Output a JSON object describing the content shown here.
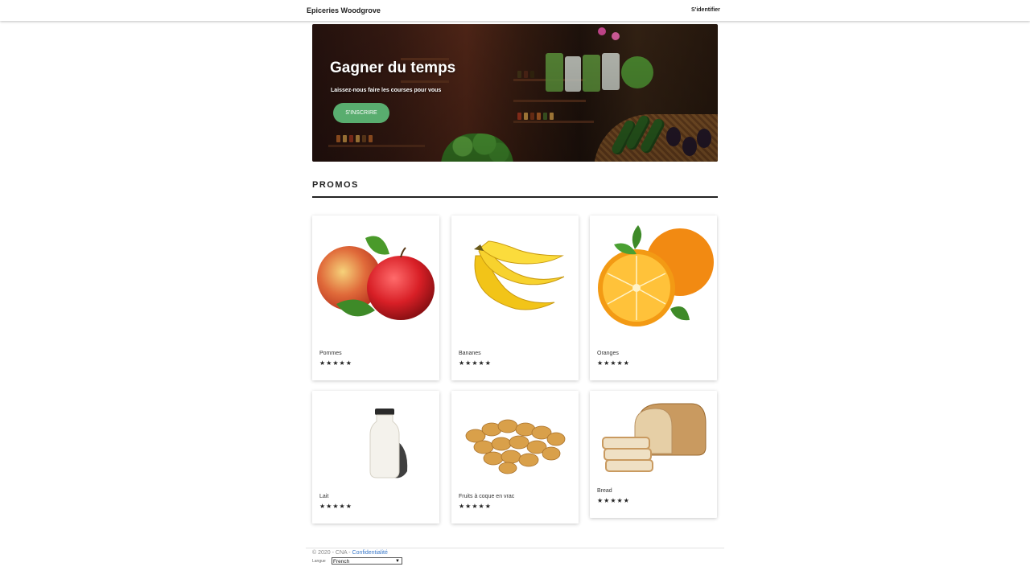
{
  "header": {
    "brand": "Epiceries Woodgrove",
    "signin_label": "S'identifier"
  },
  "hero": {
    "title": "Gagner du temps",
    "subtitle": "Laissez-nous faire les courses pour vous",
    "cta_label": "S'INSCRIRE",
    "cta_color": "#59ad6f"
  },
  "promos": {
    "title": "PROMOS",
    "products": [
      {
        "name": "Pommes",
        "rating": "★★★★★",
        "icon": "apple-icon"
      },
      {
        "name": "Bananes",
        "rating": "★★★★★",
        "icon": "banana-icon"
      },
      {
        "name": "Oranges",
        "rating": "★★★★★",
        "icon": "orange-icon"
      },
      {
        "name": "Lait",
        "rating": "★★★★★",
        "icon": "milk-bottle-icon"
      },
      {
        "name": "Fruits à coque en vrac",
        "rating": "★★★★★",
        "icon": "peanuts-icon"
      },
      {
        "name": "Bread",
        "rating": "★★★★★",
        "icon": "bread-icon"
      }
    ]
  },
  "footer": {
    "copyright": "© 2020 - CNA - ",
    "privacy_label": "Confidentialité",
    "language_label": "Langue",
    "language_value": "French",
    "link_color": "#3b79c9"
  }
}
